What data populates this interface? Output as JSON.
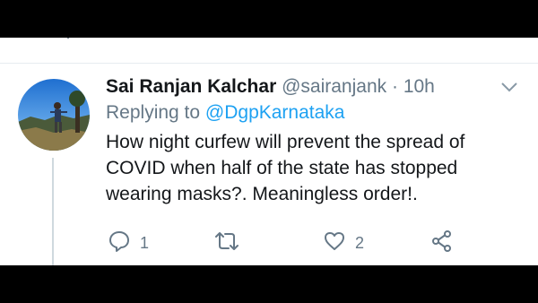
{
  "tweet": {
    "author_name": "Sai Ranjan Kalchar",
    "handle": "@sairanjank",
    "separator": "·",
    "time": "10h",
    "replying_prefix": "Replying to",
    "replying_to": "@DgpKarnataka",
    "text": "How night curfew will prevent the spread of COVID when half of the state has stopped wearing masks?. Meaningless order!."
  },
  "actions": {
    "reply_count": "1",
    "like_count": "2"
  },
  "icons": {
    "reply": "reply-icon",
    "retweet": "retweet-icon",
    "like": "heart-icon",
    "share": "share-icon",
    "more": "chevron-down-icon"
  },
  "colors": {
    "link": "#1da1f2",
    "secondary_text": "#657786",
    "primary_text": "#14171a"
  }
}
